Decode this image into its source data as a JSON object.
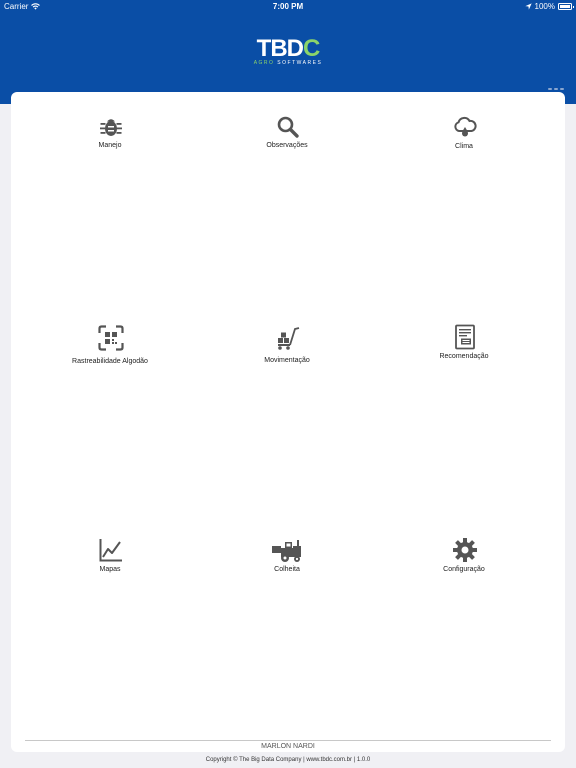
{
  "status_bar": {
    "carrier": "Carrier",
    "time": "7:00 PM",
    "battery": "100%"
  },
  "logo": {
    "main_left": "TB",
    "main_mid": "D",
    "main_right": "C",
    "sub_agro": "AGRO",
    "sub_rest": " SOFTWARES"
  },
  "menu": {
    "manejo": "Manejo",
    "observacoes": "Observações",
    "clima": "Clima",
    "rastreabilidade": "Rastreabilidade Algodão",
    "movimentacao": "Movimentação",
    "recomendacao": "Recomendação",
    "mapas": "Mapas",
    "colheita": "Colheita",
    "configuracao": "Configuração"
  },
  "icons": {
    "manejo": "bug-icon",
    "observacoes": "search-icon",
    "clima": "cloud-rain-icon",
    "rastreabilidade": "qr-scan-icon",
    "movimentacao": "hand-truck-icon",
    "recomendacao": "document-icon",
    "mapas": "line-chart-icon",
    "colheita": "harvester-icon",
    "configuracao": "gear-icon"
  },
  "footer": {
    "user": "MARLON NARDI",
    "copyright": "Copyright © The Big Data Company | www.tbdc.com.br | 1.0.0"
  },
  "colors": {
    "header": "#0a4ea6",
    "icon": "#555555",
    "accent": "#8bd46a"
  }
}
